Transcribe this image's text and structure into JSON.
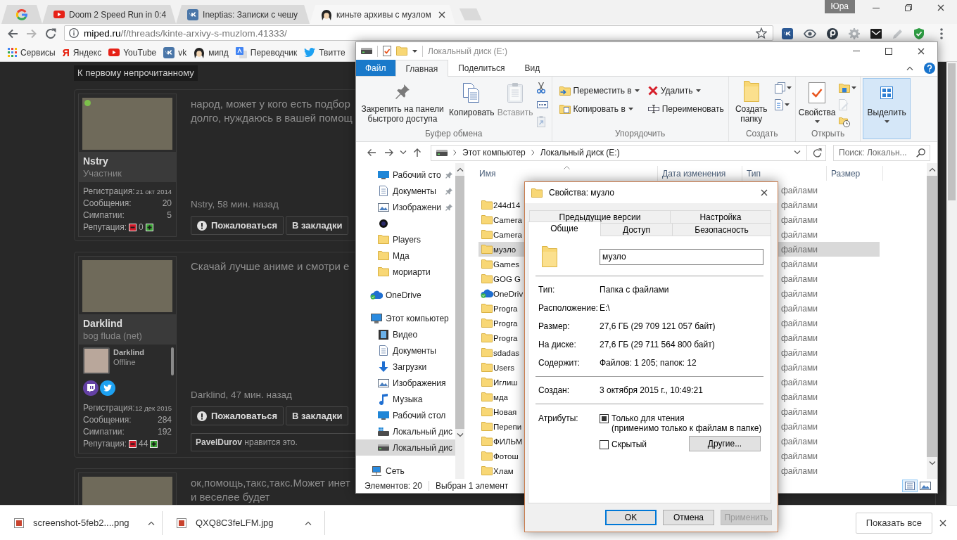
{
  "browser": {
    "profile": "Юра",
    "tabs": [
      {
        "kind": "google",
        "selected": false
      },
      {
        "kind": "video",
        "title": "Doom 2 Speed Run in 0:4",
        "selected": false
      },
      {
        "kind": "vk",
        "title": "Ineptias: Записки с чешу",
        "selected": false
      },
      {
        "kind": "forum",
        "title": "киньте архивы с музлом",
        "selected": true
      }
    ],
    "address": {
      "domain": "miped.ru",
      "path": "/f/threads/kinte-arxivy-s-muzlom.41333/"
    },
    "bookmarks": [
      {
        "kind": "apps",
        "label": "Сервисы"
      },
      {
        "kind": "letter",
        "icon_text": "Я",
        "label": "Яндекс"
      },
      {
        "kind": "video",
        "label": "YouTube"
      },
      {
        "kind": "vk",
        "label": "vk"
      },
      {
        "kind": "forum",
        "label": "мипд"
      },
      {
        "kind": "translate",
        "label": "Переводчик"
      },
      {
        "kind": "twitter",
        "label": "Твитте"
      }
    ],
    "downloads": [
      {
        "file": "screenshot-5feb2....png"
      },
      {
        "file": "QXQ8C3feLFM.jpg"
      }
    ],
    "show_all": "Показать все"
  },
  "forum": {
    "unread_link": "К первому непрочитанному",
    "posts": [
      {
        "user": {
          "name": "Nstry",
          "title": "Участник",
          "online": true
        },
        "stats": [
          {
            "label": "Регистрация:",
            "value": "21 окт 2014",
            "kind": "date"
          },
          {
            "label": "Сообщения:",
            "value": "20",
            "kind": "count"
          },
          {
            "label": "Симпатии:",
            "value": "5",
            "kind": "count"
          }
        ],
        "reputation": {
          "label": "Репутация:",
          "value": "0"
        },
        "text_lines": [
          "народ, может у кого есть подбор",
          "долго, нуждаюсь в вашей помощ"
        ],
        "meta": "Nstry, 58 мин. назад",
        "actions": [
          {
            "kind": "report",
            "label": "Пожаловаться"
          },
          {
            "kind": "bookmark",
            "label": "В закладки"
          }
        ]
      },
      {
        "user": {
          "name": "Darklind",
          "title": "bog fluda (net)",
          "online": false
        },
        "mini_profile": {
          "name": "Darklind",
          "status": "Offline"
        },
        "socials": [
          {
            "kind": "twitch"
          },
          {
            "kind": "twitter"
          }
        ],
        "stats": [
          {
            "label": "Регистрация:",
            "value": "12 дек 2015",
            "kind": "date"
          },
          {
            "label": "Сообщения:",
            "value": "284",
            "kind": "count"
          },
          {
            "label": "Симпатии:",
            "value": "192",
            "kind": "count"
          }
        ],
        "reputation": {
          "label": "Репутация:",
          "value": "44"
        },
        "text_lines": [
          "Скачай лучше аниме и смотри е"
        ],
        "meta": "Darklind, 47 мин. назад",
        "actions": [
          {
            "kind": "report",
            "label": "Пожаловаться"
          },
          {
            "kind": "bookmark",
            "label": "В закладки"
          }
        ],
        "likes": "**PavelDurov** нравится это."
      },
      {
        "text_lines": [
          "ок,помощь,такс,такс.Может инет",
          "и веселее будет"
        ]
      }
    ]
  },
  "explorer": {
    "title": "Локальный диск (E:)",
    "ribbon_tabs": [
      {
        "label": "Файл",
        "kind": "file",
        "selected": false
      },
      {
        "label": "Главная",
        "kind": "tab",
        "selected": true
      },
      {
        "label": "Поделиться",
        "kind": "tab",
        "selected": false
      },
      {
        "label": "Вид",
        "kind": "tab",
        "selected": false
      }
    ],
    "ribbon_groups": [
      {
        "label": "Буфер обмена",
        "highlighted": false,
        "columns": [
          {
            "commands": [
              {
                "kind": "pin",
                "label": "Закрепить на панели быстрого доступа",
                "disabled": false
              }
            ]
          },
          {
            "commands": [
              {
                "kind": "copy",
                "label": "Копировать",
                "disabled": false
              }
            ]
          },
          {
            "commands": [
              {
                "kind": "paste",
                "label": "Вставить",
                "disabled": true
              }
            ]
          },
          {
            "commands": [
              {
                "kind": "cut",
                "disabled": false
              },
              {
                "kind": "copy_path",
                "disabled": false
              },
              {
                "kind": "paste_shortcut",
                "disabled": true
              }
            ]
          }
        ]
      },
      {
        "label": "Упорядочить",
        "highlighted": false,
        "columns": [
          {
            "commands": [
              {
                "kind": "move_to",
                "label": "Переместить в",
                "disabled": false
              },
              {
                "kind": "copy_to",
                "label": "Копировать в",
                "disabled": false
              }
            ]
          },
          {
            "commands": [
              {
                "kind": "delete",
                "label": "Удалить",
                "disabled": false
              },
              {
                "kind": "rename",
                "label": "Переименовать",
                "disabled": false
              }
            ]
          }
        ]
      },
      {
        "label": "Создать",
        "highlighted": false,
        "columns": [
          {
            "commands": [
              {
                "kind": "new_folder",
                "label": "Создать папку",
                "disabled": false
              }
            ]
          },
          {
            "commands": [
              {
                "kind": "new_item",
                "disabled": false
              },
              {
                "kind": "easy_access",
                "disabled": false
              }
            ]
          }
        ]
      },
      {
        "label": "Открыть",
        "highlighted": false,
        "columns": [
          {
            "commands": [
              {
                "kind": "properties",
                "label": "Свойства",
                "disabled": false
              }
            ]
          },
          {
            "commands": [
              {
                "kind": "open",
                "disabled": false
              },
              {
                "kind": "edit",
                "disabled": true
              },
              {
                "kind": "history",
                "disabled": false
              }
            ]
          }
        ]
      },
      {
        "highlighted": true,
        "columns": [
          {
            "commands": [
              {
                "kind": "select",
                "label": "Выделить",
                "disabled": false
              }
            ]
          }
        ]
      }
    ],
    "path": [
      "Этот компьютер",
      "Локальный диск (E:)"
    ],
    "search_placeholder": "Поиск: Локальн...",
    "nav_pane": {
      "quick_access": [
        {
          "kind": "desktop",
          "label": "Рабочий сто",
          "pinned": true,
          "selected": false
        },
        {
          "kind": "documents",
          "label": "Документы",
          "pinned": true,
          "selected": false
        },
        {
          "kind": "pictures",
          "label": "Изображени",
          "pinned": true,
          "selected": false
        },
        {
          "kind": "app",
          "pinned": false,
          "selected": false
        },
        {
          "kind": "folder",
          "label": "Players",
          "pinned": false,
          "selected": false
        },
        {
          "kind": "folder",
          "label": "Мда",
          "pinned": false,
          "selected": false
        },
        {
          "kind": "folder",
          "label": "мориарти",
          "pinned": false,
          "selected": false
        }
      ],
      "tree": [
        {
          "kind": "onedrive",
          "label": "OneDrive",
          "selected": false
        },
        {
          "kind": "computer",
          "label": "Этот компьютер",
          "selected": false,
          "children": [
            {
              "kind": "videos",
              "label": "Видео",
              "selected": false
            },
            {
              "kind": "documents",
              "label": "Документы",
              "selected": false
            },
            {
              "kind": "downloads",
              "label": "Загрузки",
              "selected": false
            },
            {
              "kind": "pictures",
              "label": "Изображения",
              "selected": false
            },
            {
              "kind": "music",
              "label": "Музыка",
              "selected": false
            },
            {
              "kind": "desktop",
              "label": "Рабочий стол",
              "selected": false
            },
            {
              "kind": "system_drive",
              "label": "Локальный дис",
              "selected": false
            },
            {
              "kind": "drive",
              "label": "Локальный дис",
              "selected": true
            }
          ]
        },
        {
          "kind": "network",
          "label": "Сеть",
          "selected": false
        }
      ]
    },
    "columns": [
      {
        "label": "Имя",
        "sorted": true
      },
      {
        "label": "Дата изменения",
        "sorted": false
      },
      {
        "label": "Тип",
        "sorted": false
      },
      {
        "label": "Размер",
        "sorted": false
      }
    ],
    "rows": [
      {
        "type": "файлами",
        "selected": false
      },
      {
        "kind": "folder",
        "name": "244d14",
        "type": "файлами",
        "selected": false
      },
      {
        "kind": "folder",
        "name": "Camera",
        "type": "файлами",
        "selected": false
      },
      {
        "kind": "folder",
        "name": "Camera",
        "type": "файлами",
        "selected": false
      },
      {
        "kind": "folder",
        "name": "музло",
        "type": "файлами",
        "selected": true
      },
      {
        "kind": "folder",
        "name": "Games",
        "type": "файлами",
        "selected": false
      },
      {
        "kind": "folder",
        "name": "GOG G",
        "type": "файлами",
        "selected": false
      },
      {
        "kind": "onedrive",
        "name": "OneDriv",
        "type": "файлами",
        "selected": false
      },
      {
        "kind": "folder",
        "name": "Progra",
        "type": "файлами",
        "selected": false
      },
      {
        "kind": "folder",
        "name": "Progra",
        "type": "файлами",
        "selected": false
      },
      {
        "kind": "folder",
        "name": "Progra",
        "type": "файлами",
        "selected": false
      },
      {
        "kind": "folder",
        "name": "sdadas",
        "type": "файлами",
        "selected": false
      },
      {
        "kind": "folder",
        "name": "Users",
        "type": "файлами",
        "selected": false
      },
      {
        "kind": "folder",
        "name": "Иглиш",
        "type": "файлами",
        "selected": false
      },
      {
        "kind": "folder",
        "name": "мда",
        "type": "файлами",
        "selected": false
      },
      {
        "kind": "folder",
        "name": "Новая",
        "type": "файлами",
        "selected": false
      },
      {
        "kind": "folder",
        "name": "Перепи",
        "type": "файлами",
        "selected": false
      },
      {
        "kind": "folder",
        "name": "ФИЛЬМ",
        "type": "файлами",
        "selected": false
      },
      {
        "kind": "folder",
        "name": "Фотош",
        "type": "файлами",
        "selected": false
      },
      {
        "kind": "folder",
        "name": "Хлам",
        "type": "файлами",
        "selected": false
      }
    ],
    "status": {
      "count": "Элементов: 20",
      "selection": "Выбран 1 элемент"
    },
    "views": [
      {
        "kind": "details",
        "selected": true
      },
      {
        "kind": "tiles",
        "selected": false
      }
    ]
  },
  "properties": {
    "title": "Свойства: музло",
    "tab_rows": [
      {
        "tabs": [
          {
            "label": "Предыдущие версии",
            "selected": false
          },
          {
            "label": "Настройка",
            "selected": false
          }
        ]
      },
      {
        "tabs": [
          {
            "label": "Общие",
            "selected": true
          },
          {
            "label": "Доступ",
            "selected": false
          },
          {
            "label": "Безопасность",
            "selected": false
          }
        ]
      }
    ],
    "name": "музло",
    "sections": [
      {
        "rows": [
          {
            "label": "Тип:",
            "value": "Папка с файлами"
          },
          {
            "label": "Расположение:",
            "value": "E:\\"
          },
          {
            "label": "Размер:",
            "value": "27,6 ГБ (29 709 121 057 байт)"
          },
          {
            "label": "На диске:",
            "value": "27,6 ГБ (29 711 564 800 байт)"
          },
          {
            "label": "Содержит:",
            "value": "Файлов: 1 205; папок: 12"
          }
        ]
      },
      {
        "rows": [
          {
            "label": "Создан:",
            "value": "3 октября 2015 г., 10:49:21"
          }
        ]
      }
    ],
    "attributes_label": "Атрибуты:",
    "attributes": [
      {
        "label": "Только для чтения",
        "note": "(применимо только к файлам в папке)",
        "checked": false,
        "indeterminate": true
      },
      {
        "label": "Скрытый",
        "checked": false,
        "indeterminate": false
      }
    ],
    "advanced_button": "Другие...",
    "buttons": [
      {
        "label": "OK",
        "default": true,
        "disabled": false
      },
      {
        "label": "Отмена",
        "default": false,
        "disabled": false
      },
      {
        "label": "Применить",
        "default": false,
        "disabled": true
      }
    ]
  }
}
